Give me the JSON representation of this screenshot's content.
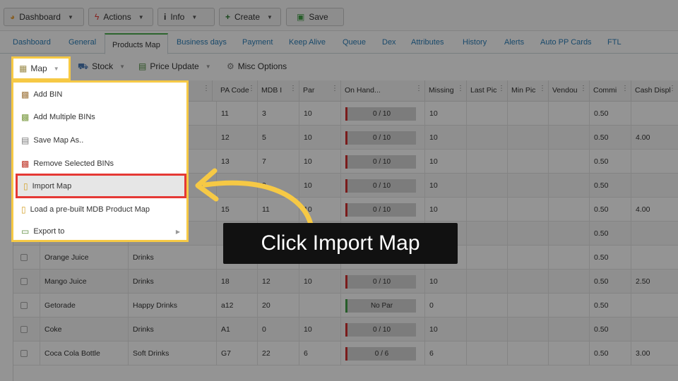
{
  "toolbar": {
    "dashboard_label": "Dashboard",
    "actions_label": "Actions",
    "info_label": "Info",
    "create_label": "Create",
    "save_label": "Save"
  },
  "tabs": [
    "Dashboard",
    "General",
    "Products Map",
    "Business days",
    "Payment",
    "Keep Alive",
    "Queue",
    "Dex",
    "Attributes",
    "History",
    "Alerts",
    "Auto PP Cards",
    "FTL"
  ],
  "active_tab": "Products Map",
  "subtoolbar": {
    "map_label": "Map",
    "stock_label": "Stock",
    "price_update_label": "Price Update",
    "misc_label": "Misc Options"
  },
  "map_menu": {
    "items": [
      {
        "label": "Add BIN",
        "icon": "add-bin-icon"
      },
      {
        "label": "Add Multiple BINs",
        "icon": "add-multiple-bins-icon"
      },
      {
        "label": "Save Map As..",
        "icon": "save-map-icon"
      },
      {
        "label": "Remove Selected BINs",
        "icon": "remove-bins-icon"
      },
      {
        "label": "Import Map",
        "icon": "import-map-icon"
      },
      {
        "label": "Load a pre-built MDB Product Map",
        "icon": "load-map-icon"
      },
      {
        "label": "Export to",
        "icon": "export-icon"
      }
    ],
    "highlighted": "Import Map"
  },
  "grid": {
    "headers": [
      "PA Code",
      "MDB I",
      "Par",
      "On Hand...",
      "Missing",
      "Last Pic",
      "Min Pic",
      "Vendou",
      "Commi",
      "Cash Displ"
    ],
    "rows": [
      {
        "name": "",
        "category": "",
        "pa": "11",
        "mdb": "3",
        "par": "10",
        "onhand": "0 / 10",
        "missing": "10",
        "commi": "0.50",
        "cash": "",
        "ok": false
      },
      {
        "name": "",
        "category": "",
        "pa": "12",
        "mdb": "5",
        "par": "10",
        "onhand": "0 / 10",
        "missing": "10",
        "commi": "0.50",
        "cash": "4.00",
        "ok": false
      },
      {
        "name": "",
        "category": "",
        "pa": "13",
        "mdb": "7",
        "par": "10",
        "onhand": "0 / 10",
        "missing": "10",
        "commi": "0.50",
        "cash": "",
        "ok": false
      },
      {
        "name": "",
        "category": "",
        "pa": "",
        "mdb": "9",
        "par": "10",
        "onhand": "0 / 10",
        "missing": "10",
        "commi": "0.50",
        "cash": "",
        "ok": false
      },
      {
        "name": "",
        "category": "",
        "pa": "15",
        "mdb": "11",
        "par": "10",
        "onhand": "0 / 10",
        "missing": "10",
        "commi": "0.50",
        "cash": "4.00",
        "ok": false
      },
      {
        "name": "",
        "category": "",
        "pa": "",
        "mdb": "",
        "par": "",
        "onhand": "",
        "missing": "",
        "commi": "0.50",
        "cash": "",
        "ok": false
      },
      {
        "name": "Orange Juice",
        "category": "Drinks",
        "pa": "",
        "mdb": "",
        "par": "",
        "onhand": "",
        "missing": "",
        "commi": "0.50",
        "cash": "",
        "ok": false
      },
      {
        "name": "Mango Juice",
        "category": "Drinks",
        "pa": "18",
        "mdb": "12",
        "par": "10",
        "onhand": "0 / 10",
        "missing": "10",
        "commi": "0.50",
        "cash": "2.50",
        "ok": false
      },
      {
        "name": "Getorade",
        "category": "Happy Drinks",
        "pa": "a12",
        "mdb": "20",
        "par": "",
        "onhand": "No Par",
        "missing": "0",
        "commi": "0.50",
        "cash": "",
        "ok": true
      },
      {
        "name": "Coke",
        "category": "Drinks",
        "pa": "A1",
        "mdb": "0",
        "par": "10",
        "onhand": "0 / 10",
        "missing": "10",
        "commi": "0.50",
        "cash": "",
        "ok": false
      },
      {
        "name": "Coca Cola Bottle",
        "category": "Soft Drinks",
        "pa": "G7",
        "mdb": "22",
        "par": "6",
        "onhand": "0 / 6",
        "missing": "6",
        "commi": "0.50",
        "cash": "3.00",
        "ok": false
      }
    ]
  },
  "callout_text": "Click Import Map",
  "colors": {
    "highlight": "#f6c945",
    "selected_border": "#e53935",
    "tab_accent": "#4caf50",
    "link": "#2c7fb8"
  }
}
